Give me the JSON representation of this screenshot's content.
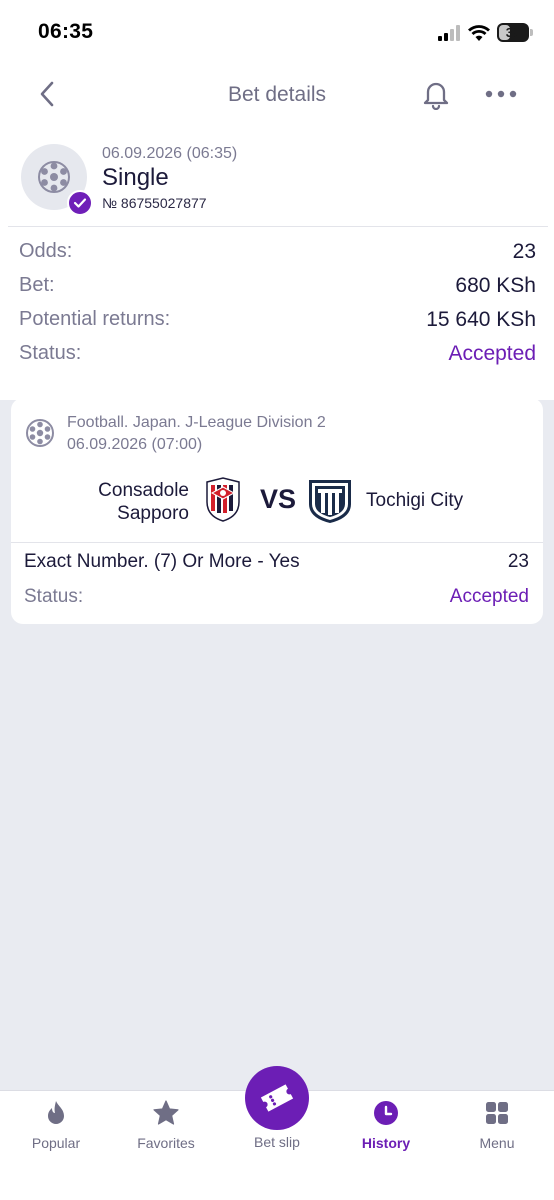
{
  "status_bar": {
    "time": "06:35",
    "battery": "39",
    "battery_level": 0.39
  },
  "header": {
    "title": "Bet details",
    "back_icon": "chevron-left-icon",
    "bell_icon": "bell-icon",
    "more_icon": "more-icon"
  },
  "bet": {
    "date": "06.09.2026 (06:35)",
    "type": "Single",
    "number": "№ 86755027877",
    "rows": [
      {
        "label": "Odds:",
        "value": "23"
      },
      {
        "label": "Bet:",
        "value": "680 KSh"
      },
      {
        "label": "Potential returns:",
        "value": "15 640 KSh"
      },
      {
        "label": "Status:",
        "value": "Accepted"
      }
    ]
  },
  "event": {
    "league": "Football. Japan. J-League Division 2",
    "date": "06.09.2026 (07:00)",
    "team1_line1": "Consadole",
    "team1_line2": "Sapporo",
    "vs": "VS",
    "team2": "Tochigi City",
    "market": "Exact Number. (7) Or More - Yes",
    "odds": "23",
    "status_label": "Status:",
    "status_value": "Accepted"
  },
  "nav": {
    "items": [
      {
        "label": "Popular",
        "icon": "flame-icon"
      },
      {
        "label": "Favorites",
        "icon": "star-icon"
      },
      {
        "label": "Bet slip",
        "icon": "ticket-icon"
      },
      {
        "label": "History",
        "icon": "clock-icon"
      },
      {
        "label": "Menu",
        "icon": "grid-icon"
      }
    ],
    "active": "History"
  },
  "colors": {
    "accent": "#6c1eb5",
    "muted": "#7b7a92",
    "text": "#1c1a3a",
    "background": "#e9ebf1"
  }
}
